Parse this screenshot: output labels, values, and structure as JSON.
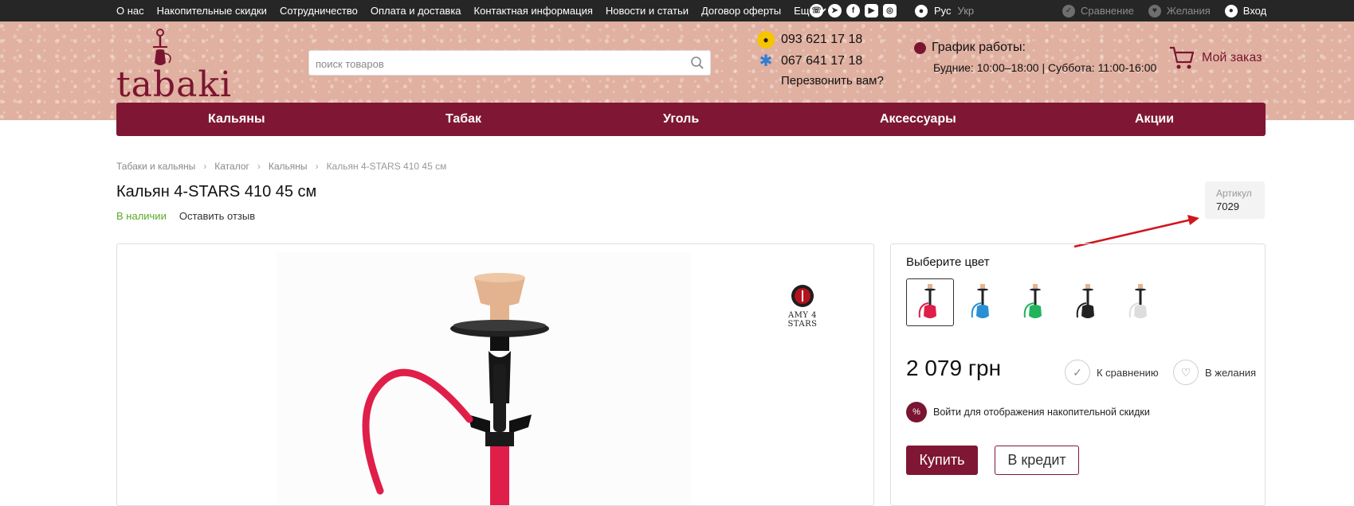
{
  "topbar": {
    "links": [
      "О нас",
      "Накопительные скидки",
      "Сотрудничество",
      "Оплата и доставка",
      "Контактная информация",
      "Новости и статьи",
      "Договор оферты"
    ],
    "more_label": "Еще",
    "socials": [
      "viber-icon",
      "telegram-icon",
      "facebook-icon",
      "youtube-icon",
      "instagram-icon"
    ],
    "lang_active": "Рус",
    "lang_other": "Укр",
    "compare_label": "Сравнение",
    "wishlist_label": "Желания",
    "login_label": "Вход"
  },
  "header": {
    "logo_text": "tabaki",
    "search_placeholder": "поиск товаров",
    "phone1": "093 621 17 18",
    "phone2": "067 641 17 18",
    "callback_label": "Перезвонить вам?",
    "schedule_title": "График работы:",
    "schedule_hours": "Будние: 10:00–18:00 | Суббота: 11:00-16:00",
    "cart_label": "Мой заказ"
  },
  "mainnav": {
    "items": [
      "Кальяны",
      "Табак",
      "Уголь",
      "Аксессуары",
      "Акции"
    ]
  },
  "breadcrumb": {
    "items": [
      "Табаки и кальяны",
      "Каталог",
      "Кальяны"
    ],
    "current": "Кальян 4-STARS 410 45 см"
  },
  "product": {
    "title": "Кальян 4-STARS 410 45 см",
    "stock": "В наличии",
    "review_link": "Оставить отзыв",
    "sku_label": "Артикул",
    "sku_value": "7029",
    "brand_text": "AMY 4 STARS",
    "choose_color_label": "Выберите цвет",
    "colors": [
      {
        "name": "red",
        "hex": "#e01e4a"
      },
      {
        "name": "blue",
        "hex": "#2a8fd6"
      },
      {
        "name": "green",
        "hex": "#22b45a"
      },
      {
        "name": "black",
        "hex": "#222222"
      },
      {
        "name": "white",
        "hex": "#dddddd"
      }
    ],
    "price": "2 079 грн",
    "compare_action": "К сравнению",
    "wishlist_action": "В желания",
    "discount_login": "Войти",
    "discount_text": "для отображения накопительной скидки",
    "buy_label": "Купить",
    "credit_label": "В кредит"
  },
  "colors": {
    "brand": "#7f1734",
    "stock_green": "#5aa928",
    "annotation_arrow": "#d0161c"
  }
}
